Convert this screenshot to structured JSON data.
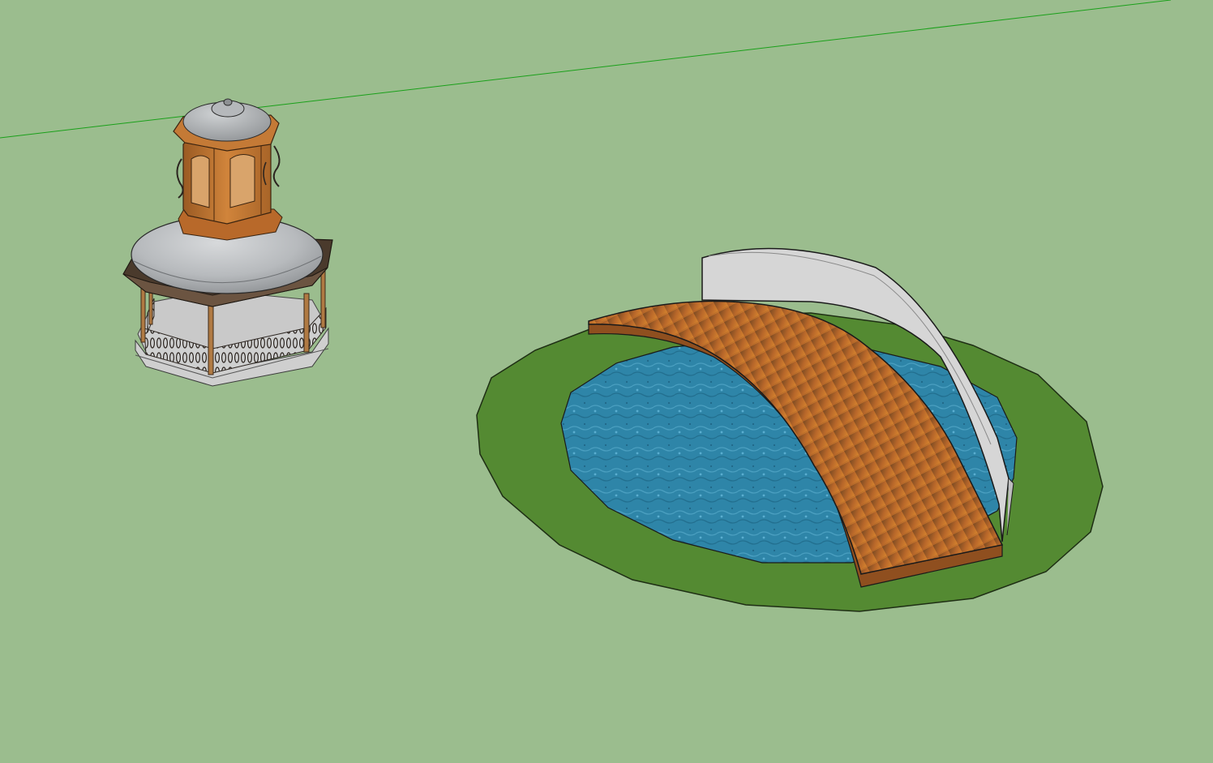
{
  "viewport": {
    "background": "#9bbd8e",
    "axis_color": "#1aa01a",
    "objects": [
      {
        "name": "gazebo",
        "roof_color": "#b7babd",
        "wood_color": "#c77a35",
        "frame_color": "#4a3a2c",
        "floor_color": "#c9c9c9"
      },
      {
        "name": "pond",
        "grass_color": "#548a32",
        "water_color": "#2e85a8"
      },
      {
        "name": "arched-bridge",
        "deck_color": "#b8672a",
        "wall_color": "#d6d6d6"
      }
    ]
  }
}
